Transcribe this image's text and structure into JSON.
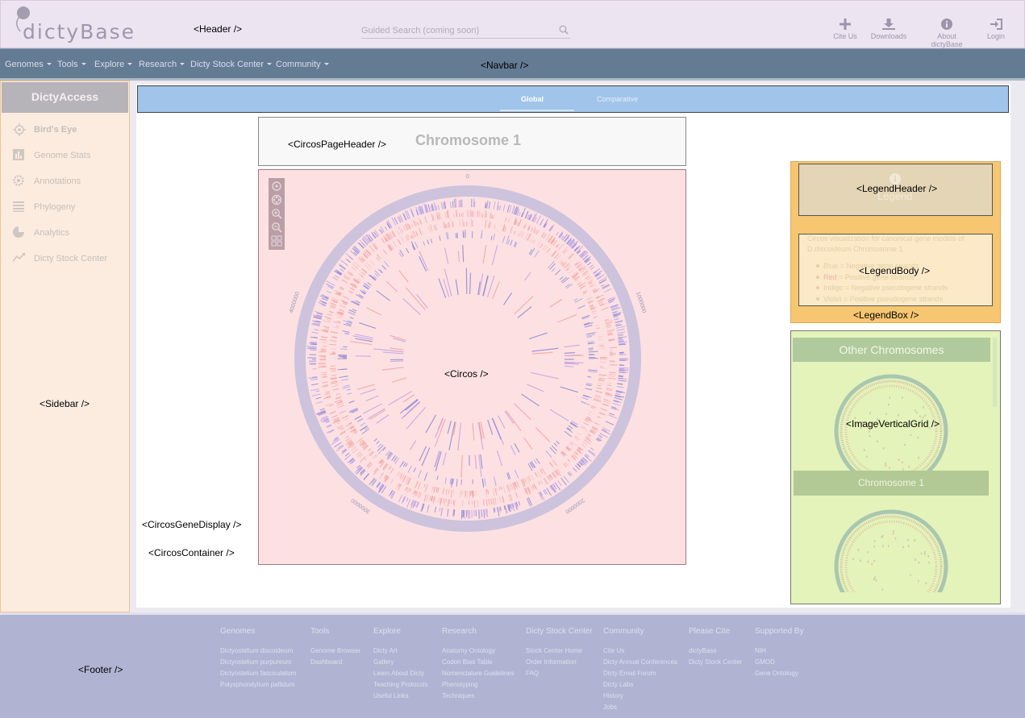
{
  "component_labels": {
    "header": "<Header />",
    "navbar": "<Navbar />",
    "sidebar": "<Sidebar />",
    "circos_page_header": "<CircosPageHeader />",
    "circos": "<Circos />",
    "circos_gene_display": "<CircosGeneDisplay />",
    "circos_container": "<CircosContainer />",
    "legend_header": "<LegendHeader />",
    "legend_body": "<LegendBody />",
    "legend_box": "<LegendBox />",
    "image_vertical_grid": "<ImageVerticalGrid />",
    "footer": "<Footer />"
  },
  "header": {
    "logo": "dictyBase",
    "search_placeholder": "Guided Search (coming soon)",
    "buttons": [
      {
        "label": "Cite Us",
        "icon": "plus-icon"
      },
      {
        "label": "Downloads",
        "icon": "download-icon"
      },
      {
        "label": "About dictyBase",
        "icon": "info-icon"
      },
      {
        "label": "Login",
        "icon": "login-icon"
      }
    ]
  },
  "navbar": {
    "items": [
      "Genomes",
      "Tools",
      "Explore",
      "Research",
      "Dicty Stock Center",
      "Community"
    ]
  },
  "sidebar": {
    "title": "DictyAccess",
    "items": [
      "Bird's Eye",
      "Genome Stats",
      "Annotations",
      "Phylogeny",
      "Analytics",
      "Dicty Stock Center"
    ]
  },
  "tabs": [
    "Global",
    "Comparative"
  ],
  "circos": {
    "title": "Chromosome 1",
    "ticks": [
      "0",
      "1000000",
      "2000000",
      "3000000",
      "4000000"
    ]
  },
  "legend": {
    "title": "Legend",
    "intro": "Circos visualization for canonical gene models of D.discoideum Chromosome 1.",
    "items": [
      {
        "color_word": "Blue",
        "text": " = Negative gene strands"
      },
      {
        "color_word": "Red",
        "text": " = Positive gene strands"
      },
      {
        "color_word": "Indigo",
        "text": " = Negative pseudogene strands"
      },
      {
        "color_word": "Violet",
        "text": " = Positive pseudogene strands"
      }
    ],
    "colors": {
      "blue": "#a9a6e8",
      "red": "#f2a5a5",
      "indigo": "#8f89d3",
      "violet": "#c6a4e3"
    }
  },
  "other_chromosomes": {
    "title": "Other Chromosomes",
    "label": "Chromosome 1"
  },
  "footer": {
    "columns": [
      {
        "title": "Genomes",
        "links": [
          "Dictyostelium discoideum",
          "Dictyostelium purpureum",
          "Dictyostelium fasciculatum",
          "Polysphondylium pallidum"
        ]
      },
      {
        "title": "Tools",
        "links": [
          "Genome Browser",
          "Dashboard"
        ]
      },
      {
        "title": "Explore",
        "links": [
          "Dicty Art",
          "Gallery",
          "Learn About Dicty",
          "Teaching Protocols",
          "Useful Links"
        ]
      },
      {
        "title": "Research",
        "links": [
          "Anatomy Ontology",
          "Codon Bias Table",
          "Nomenclature Guidelines",
          "Phenotyping",
          "Techniques"
        ]
      },
      {
        "title": "Dicty Stock Center",
        "links": [
          "Stock Center Home",
          "Order Information",
          "FAQ"
        ]
      },
      {
        "title": "Community",
        "links": [
          "Cite Us",
          "Dicty Annual Conferences",
          "Dicty Email Forum",
          "Dicty Labs",
          "History",
          "Jobs"
        ]
      },
      {
        "title": "Please Cite",
        "links": [
          "dictyBase",
          "Dicty Stock Center"
        ]
      },
      {
        "title": "Supported By",
        "links": [
          "NIH",
          "GMOD",
          "Gene Ontology"
        ]
      }
    ]
  }
}
